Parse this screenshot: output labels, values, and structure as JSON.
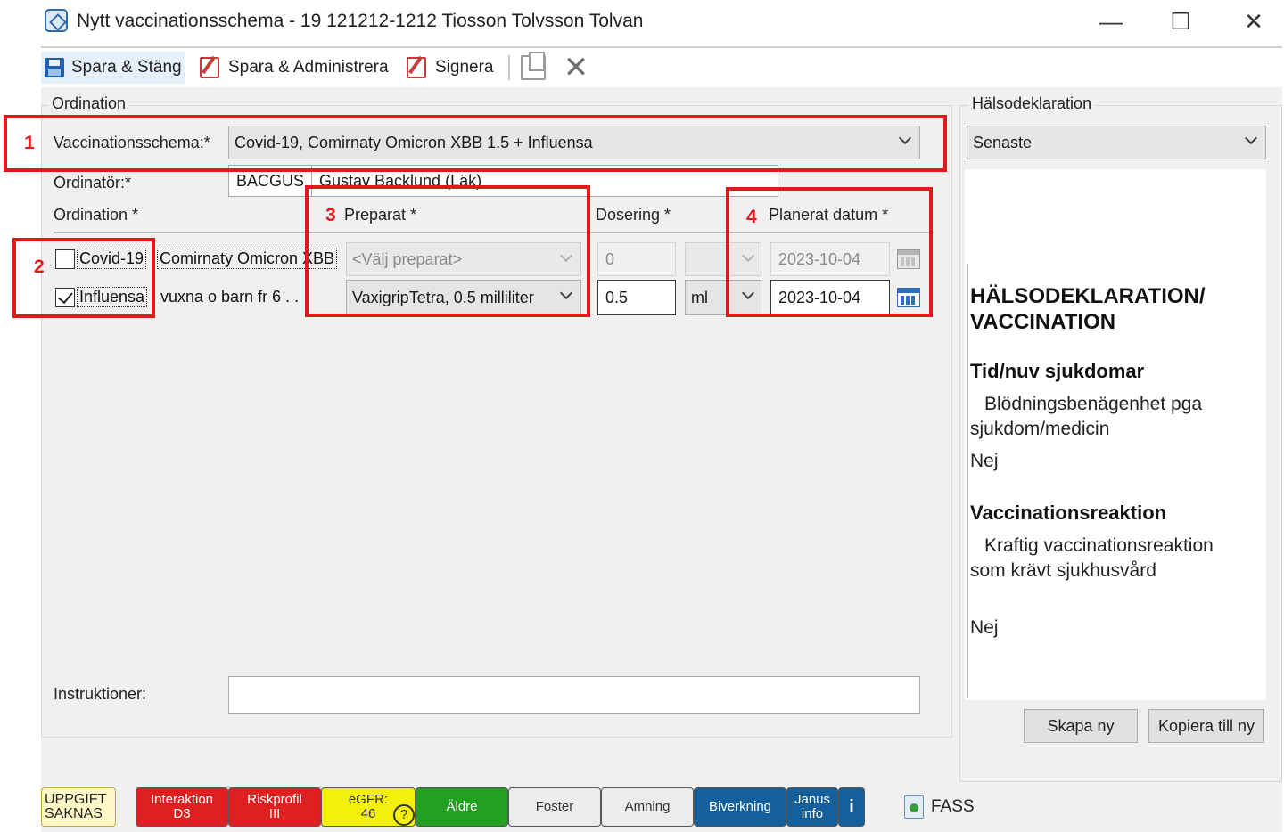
{
  "window": {
    "title": "Nytt vaccinationsschema - 19 121212-1212 Tiosson Tolvsson Tolvan",
    "minimize": "—",
    "maximize": "☐",
    "close": "✕"
  },
  "toolbar": {
    "save_close": "Spara & Stäng",
    "save_admin": "Spara & Administrera",
    "sign": "Signera",
    "cancel": "✕"
  },
  "ordination": {
    "legend": "Ordination",
    "schema_label": "Vaccinationsschema:*",
    "schema_value": "Covid-19, Comirnaty Omicron XBB 1.5 + Influensa",
    "prescriber_label": "Ordinatör:*",
    "prescriber_code": "BACGUS",
    "prescriber_name": "Gustav Backlund (Läk)",
    "columns": {
      "ordination": "Ordination *",
      "preparat": "Preparat *",
      "dosering": "Dosering *",
      "planned_date": "Planerat datum *"
    },
    "rows": [
      {
        "checked": false,
        "name": "Covid-19",
        "detail": "Comirnaty Omicron XBB",
        "preparat": "<Välj preparat>",
        "dose": "0",
        "unit": "",
        "date": "2023-10-04"
      },
      {
        "checked": true,
        "name": "Influensa",
        "detail": "vuxna o barn fr 6 . .",
        "preparat": "VaxigripTetra, 0.5 milliliter",
        "dose": "0.5",
        "unit": "ml",
        "date": "2023-10-04"
      }
    ],
    "instructions_label": "Instruktioner:",
    "instructions_value": ""
  },
  "annotations": [
    "1",
    "2",
    "3",
    "4"
  ],
  "health_declaration": {
    "legend": "Hälsodeklaration",
    "selected": "Senaste",
    "heading": "HÄLSODEKLARATION/ VACCINATION",
    "sections": [
      {
        "title": "Tid/nuv sjukdomar",
        "question": "Blödningsbenägenhet pga sjukdom/medicin",
        "answer": "Nej"
      },
      {
        "title": "Vaccinationsreaktion",
        "question": "Kraftig vaccinationsreaktion som krävt sjukhusvård",
        "answer": "Nej"
      }
    ],
    "create_new": "Skapa ny",
    "copy_to_new": "Kopiera till ny"
  },
  "badges": {
    "missing_1": "UPPGIFT",
    "missing_2": "SAKNAS",
    "interaction_1": "Interaktion",
    "interaction_2": "D3",
    "riskprofile_1": "Riskprofil",
    "riskprofile_2": "III",
    "egfr_1": "eGFR:",
    "egfr_2": "46",
    "egfr_q": "?",
    "elderly": "Äldre",
    "fetus": "Foster",
    "breastfeeding": "Amning",
    "side_effects": "Biverkning",
    "janus_1": "Janus",
    "janus_2": "info",
    "info": "i",
    "fass": "FASS"
  },
  "colors": {
    "annotation_red": "#e01a1a",
    "badge_red": "#e02020",
    "badge_yellow": "#f5f00a",
    "badge_green": "#22a021",
    "badge_blue": "#14609c",
    "badge_missing": "#fff8c6",
    "calendar_active": "#2d6cc0"
  }
}
